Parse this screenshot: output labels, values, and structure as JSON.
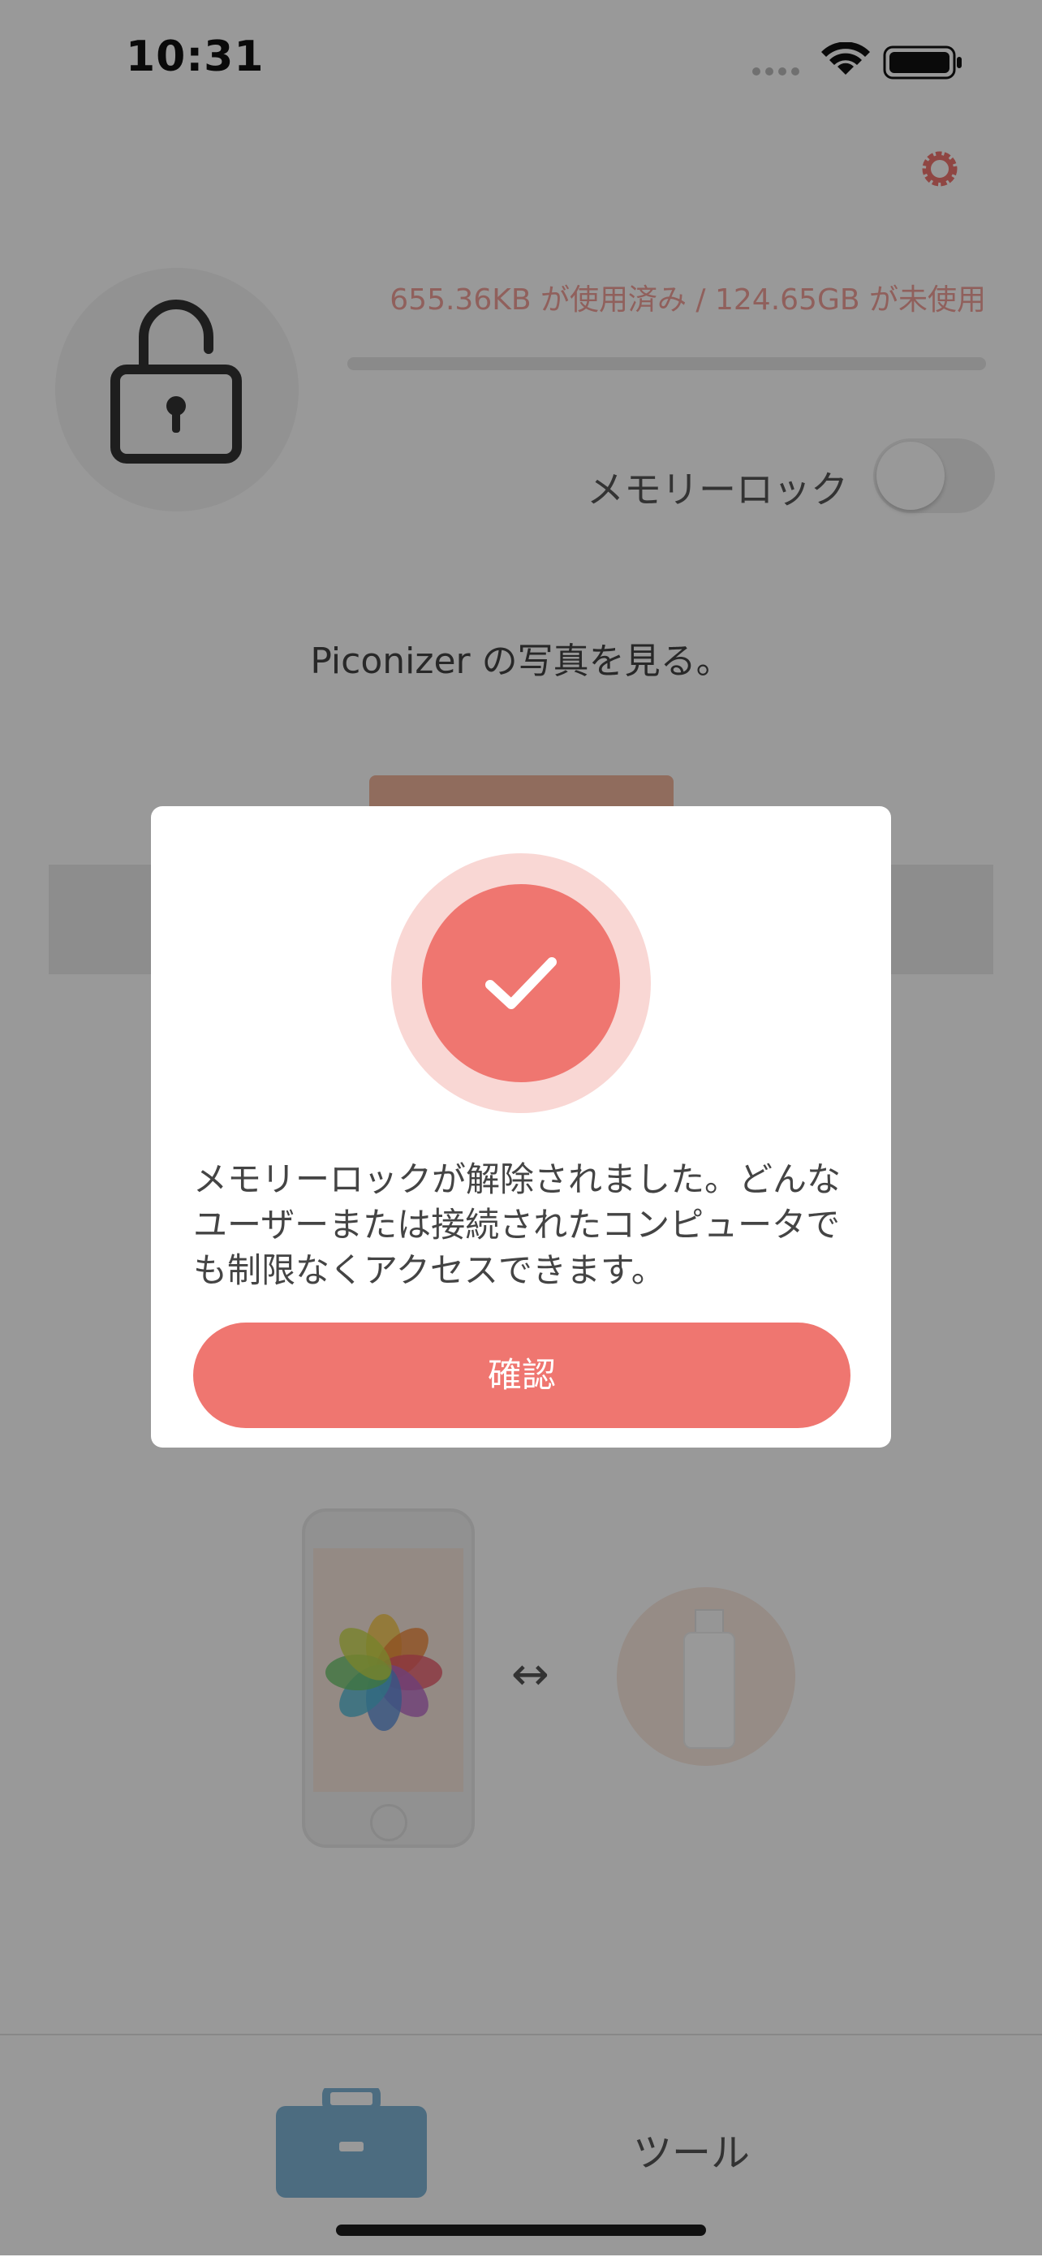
{
  "status_bar": {
    "time": "10:31"
  },
  "storage": {
    "text": "655.36KB が使用済み / 124.65GB が未使用",
    "used_fraction": 0.0
  },
  "memory_lock": {
    "label": "メモリーロック",
    "enabled": false
  },
  "photos": {
    "text": "Piconizer の写真を見る。"
  },
  "transfer": {
    "arrow": "↔"
  },
  "tabbar": {
    "tools_label": "ツール"
  },
  "dialog": {
    "message": "メモリーロックが解除されました。どんなユーザーまたは接続されたコンピュータでも制限なくアクセスできます。",
    "confirm_label": "確認"
  },
  "colors": {
    "accent": "#ef7670",
    "accent_light": "#f9d7d4",
    "overlay": "rgba(0,0,0,0.4)",
    "tab_icon": "#7fb4d6"
  },
  "icons": [
    "signal-icon",
    "wifi-icon",
    "battery-icon",
    "gear-icon",
    "unlocked-padlock-icon",
    "checkmark-icon",
    "photos-icon",
    "usb-drive-icon",
    "toolbox-icon"
  ]
}
